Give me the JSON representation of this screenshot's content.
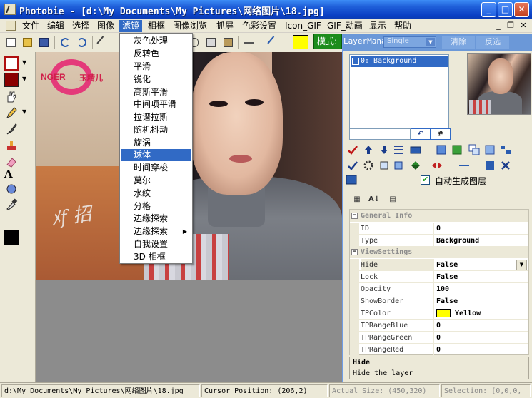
{
  "window": {
    "title": "Photobie - [d:\\My Documents\\My Pictures\\网络图片\\18.jpg]",
    "minimize": "_",
    "maximize": "□",
    "close": "✕"
  },
  "menubar": {
    "items": [
      "文件",
      "编辑",
      "选择",
      "图像",
      "滤镜",
      "相框",
      "图像浏览",
      "抓屏",
      "色彩设置",
      "Icon_GIF",
      "GIF_动画",
      "显示",
      "帮助"
    ],
    "active": "滤镜",
    "mdi_min": "_",
    "mdi_restore": "❐",
    "mdi_close": "✕"
  },
  "toolbar": {
    "mode_label": "模式:",
    "fg_color": "#ffff00"
  },
  "filter_menu": {
    "items": [
      "灰色处理",
      "反转色",
      "平滑",
      "锐化",
      "高斯平滑",
      "中间项平滑",
      "拉谱拉斯",
      "随机抖动",
      "旋涡",
      "球体",
      "时间穿梭",
      "莫尔",
      "水纹",
      "分格",
      "边缘探索",
      "边缘探索",
      "自我设置",
      "3D 相框"
    ],
    "highlighted": "球体",
    "submenu_arrow": "▶"
  },
  "layer_manager": {
    "title": "LayerManager",
    "combo_value": "Single",
    "delete_label": "清除",
    "invert_label": "反选",
    "layers": [
      "0: Background"
    ],
    "undo_symbol": "↶",
    "hash_symbol": "#",
    "auto_layer_label": "自动生成图层",
    "auto_layer_checked": true
  },
  "property_grid": {
    "categories": [
      {
        "name": "General Info",
        "rows": [
          {
            "key": "ID",
            "value": "0"
          },
          {
            "key": "Type",
            "value": "Background"
          }
        ]
      },
      {
        "name": "ViewSettings",
        "rows": [
          {
            "key": "Hide",
            "value": "False"
          },
          {
            "key": "Lock",
            "value": "False"
          },
          {
            "key": "Opacity",
            "value": "100"
          },
          {
            "key": "ShowBorder",
            "value": "False"
          },
          {
            "key": "TPColor",
            "value": "Yellow"
          },
          {
            "key": "TPRangeBlue",
            "value": "0"
          },
          {
            "key": "TPRangeGreen",
            "value": "0"
          },
          {
            "key": "TPRangeRed",
            "value": "0"
          }
        ]
      }
    ],
    "help_title": "Hide",
    "help_desc": "Hide the layer",
    "collapse_symbol": "−"
  },
  "canvas": {
    "photo_logo": "NGER",
    "photo_logo_cn": "玉精儿",
    "photo_signature": "ﾒf 招"
  },
  "statusbar": {
    "path": "d:\\My Documents\\My Pictures\\网络图片\\18.jpg",
    "cursor": "Cursor Position:  (206,2)",
    "actual_size": "Actual Size:  (450,320)",
    "selection": "Selection:  [0,0,0,"
  }
}
